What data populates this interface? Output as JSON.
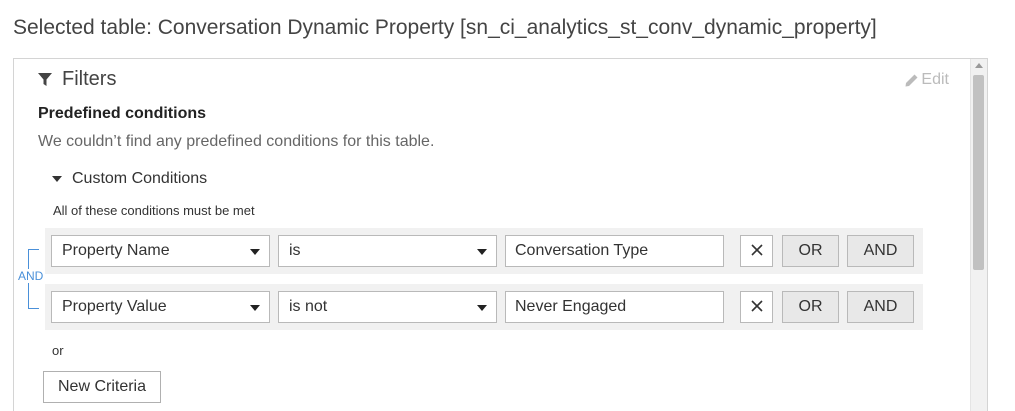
{
  "header": {
    "selected_table": "Selected table: Conversation Dynamic Property [sn_ci_analytics_st_conv_dynamic_property]"
  },
  "filters": {
    "title": "Filters",
    "edit_label": "Edit",
    "icons": {
      "filter": "filter-funnel-icon",
      "edit": "pencil-icon",
      "remove": "close-icon"
    },
    "predefined": {
      "title": "Predefined conditions",
      "empty_message": "We couldn’t find any predefined conditions for this table."
    },
    "custom": {
      "toggle_label": "Custom Conditions",
      "all_met_text": "All of these conditions must be met",
      "group_connector": "AND",
      "conditions": [
        {
          "field": "Property Name",
          "operator": "is",
          "value": "Conversation Type",
          "or_label": "OR",
          "and_label": "AND"
        },
        {
          "field": "Property Value",
          "operator": "is not",
          "value": "Never Engaged",
          "or_label": "OR",
          "and_label": "AND"
        }
      ],
      "or_text": "or",
      "new_criteria_label": "New Criteria"
    }
  }
}
